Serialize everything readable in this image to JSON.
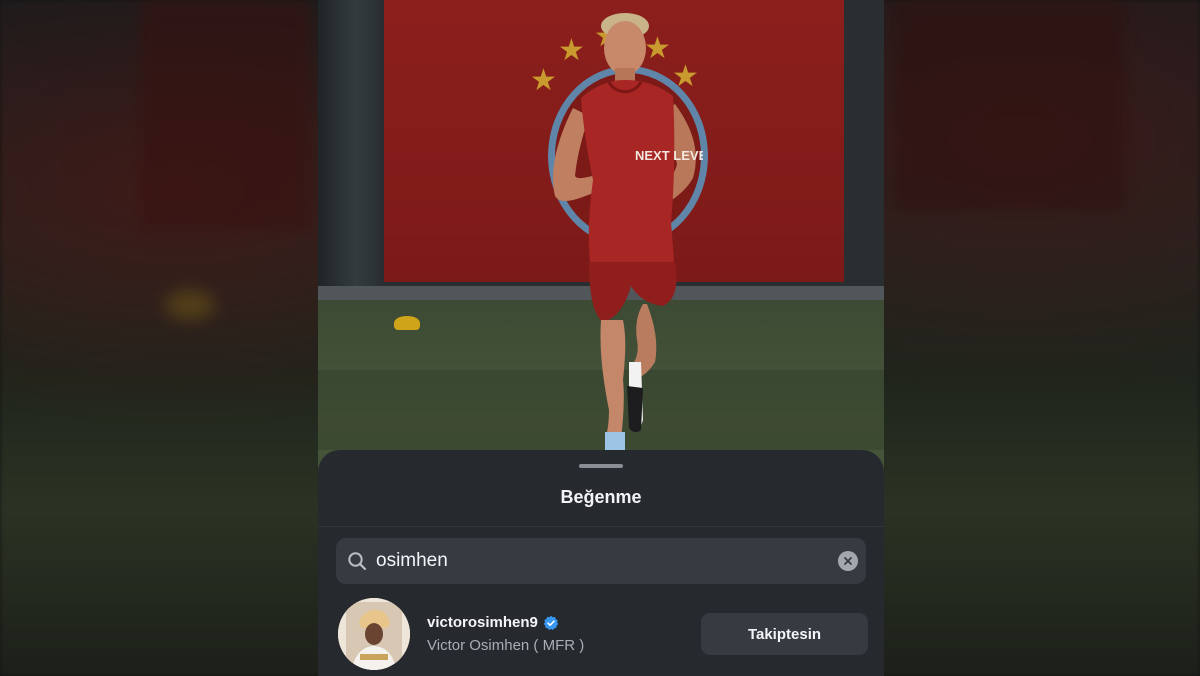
{
  "sheet": {
    "title": "Beğenme"
  },
  "search": {
    "query": "osimhen"
  },
  "results": [
    {
      "username": "victorosimhen9",
      "full_name": "Victor Osimhen ( MFR )",
      "verified": true,
      "follow_label": "Takiptesin"
    }
  ],
  "photo": {
    "jersey_text": "NEXT LEVEL"
  },
  "icons": {
    "search": "search-icon",
    "clear": "clear-icon",
    "verified": "verified-badge-icon"
  },
  "colors": {
    "sheet_background": "#262a2f",
    "field_background": "#363b41",
    "verified_blue": "#3897f0",
    "banner_red": "#8c1f1c"
  }
}
